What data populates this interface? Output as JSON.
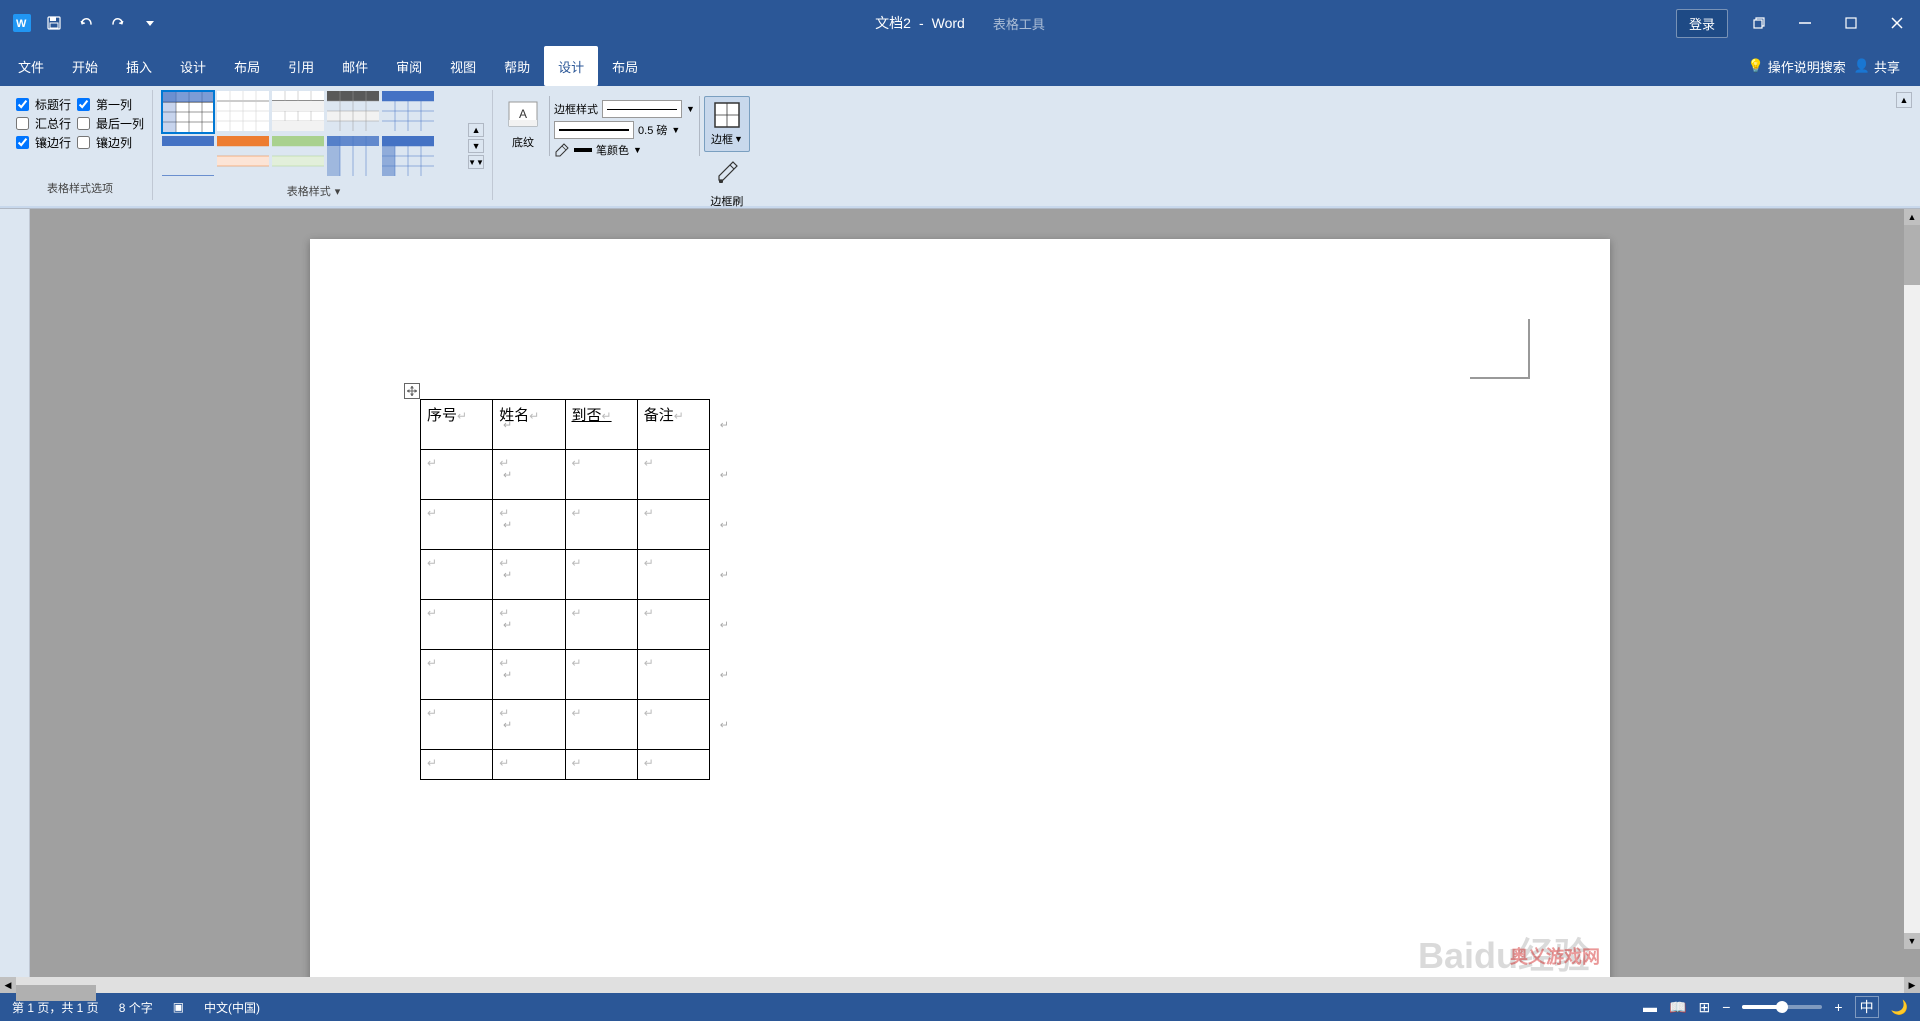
{
  "titleBar": {
    "docName": "文档2",
    "appName": "Word",
    "tableTools": "表格工具",
    "loginBtn": "登录",
    "quickAccess": [
      "save",
      "undo",
      "redo",
      "customize"
    ]
  },
  "menuBar": {
    "items": [
      "文件",
      "开始",
      "插入",
      "设计",
      "布局",
      "引用",
      "邮件",
      "审阅",
      "视图",
      "帮助",
      "设计",
      "布局"
    ],
    "activeIndex": 10,
    "search": {
      "icon": "🔍",
      "label": "操作说明搜索"
    },
    "share": "共享"
  },
  "ribbon": {
    "groups": [
      {
        "label": "表格样式选项",
        "checkboxes": [
          {
            "label": "标题行",
            "checked": true
          },
          {
            "label": "第一列",
            "checked": true
          },
          {
            "label": "汇总行",
            "checked": false
          },
          {
            "label": "最后一列",
            "checked": false
          },
          {
            "label": "镶边行",
            "checked": true
          },
          {
            "label": "镶边列",
            "checked": false
          }
        ]
      },
      {
        "label": "表格样式"
      },
      {
        "label": "边框",
        "shadingLabel": "底纹",
        "borderStyleLabel": "边框样式",
        "borderWeightLabel": "0.5 磅",
        "penColorLabel": "笔颜色",
        "borderBtn": "边框",
        "brushBtn": "边框刷"
      }
    ]
  },
  "table": {
    "headers": [
      "序号↵",
      "姓名↵",
      "到否↵",
      "备注↵"
    ],
    "rows": 7
  },
  "statusBar": {
    "page": "第 1 页，共 1 页",
    "words": "8 个字",
    "lang": "中文(中国)",
    "inputMode": "中",
    "moon": "🌙"
  }
}
